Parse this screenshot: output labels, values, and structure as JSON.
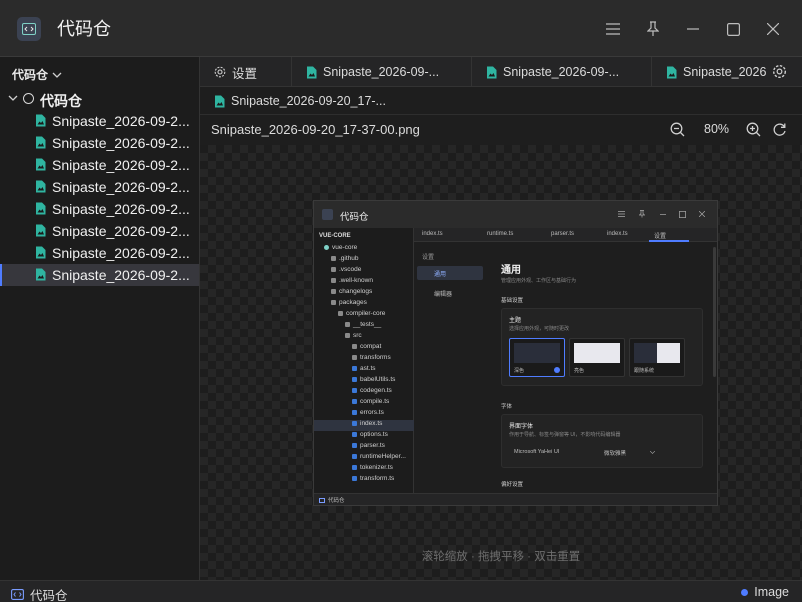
{
  "app": {
    "title": "代码仓",
    "accent": "#4f7cff"
  },
  "sidebar": {
    "header": "代码仓",
    "root": "代码仓",
    "files": [
      "Snipaste_2026-09-2...",
      "Snipaste_2026-09-2...",
      "Snipaste_2026-09-2...",
      "Snipaste_2026-09-2...",
      "Snipaste_2026-09-2...",
      "Snipaste_2026-09-2...",
      "Snipaste_2026-09-2...",
      "Snipaste_2026-09-2..."
    ],
    "active_index": 7
  },
  "tabs": [
    {
      "label": "设置",
      "icon": "gear-icon"
    },
    {
      "label": "Snipaste_2026-09-...",
      "icon": "image-file-icon"
    },
    {
      "label": "Snipaste_2026-09-...",
      "icon": "image-file-icon"
    },
    {
      "label": "Snipaste_2026",
      "icon": "image-file-icon"
    }
  ],
  "tabs_row2": [
    {
      "label": "Snipaste_2026-09-20_17-...",
      "icon": "image-file-icon"
    }
  ],
  "viewer": {
    "filename": "Snipaste_2026-09-20_17-37-00.png",
    "zoom": "80%",
    "hint": "滚轮缩放 · 拖拽平移 · 双击重置"
  },
  "preview": {
    "title": "代码仓",
    "explorer_header": "VUE-CORE",
    "tree": [
      {
        "label": "vue-core",
        "depth": 0,
        "type": "root"
      },
      {
        "label": ".github",
        "depth": 1,
        "type": "folder"
      },
      {
        "label": ".vscode",
        "depth": 1,
        "type": "folder"
      },
      {
        "label": ".well-known",
        "depth": 1,
        "type": "folder"
      },
      {
        "label": "changelogs",
        "depth": 1,
        "type": "folder"
      },
      {
        "label": "packages",
        "depth": 1,
        "type": "folder"
      },
      {
        "label": "compiler-core",
        "depth": 2,
        "type": "folder"
      },
      {
        "label": "__tests__",
        "depth": 3,
        "type": "folder"
      },
      {
        "label": "src",
        "depth": 3,
        "type": "folder"
      },
      {
        "label": "compat",
        "depth": 4,
        "type": "folder"
      },
      {
        "label": "transforms",
        "depth": 4,
        "type": "folder"
      },
      {
        "label": "ast.ts",
        "depth": 4,
        "type": "ts"
      },
      {
        "label": "babelUtils.ts",
        "depth": 4,
        "type": "ts"
      },
      {
        "label": "codegen.ts",
        "depth": 4,
        "type": "ts"
      },
      {
        "label": "compile.ts",
        "depth": 4,
        "type": "ts"
      },
      {
        "label": "errors.ts",
        "depth": 4,
        "type": "ts"
      },
      {
        "label": "index.ts",
        "depth": 4,
        "type": "ts"
      },
      {
        "label": "options.ts",
        "depth": 4,
        "type": "ts"
      },
      {
        "label": "parser.ts",
        "depth": 4,
        "type": "ts"
      },
      {
        "label": "runtimeHelper...",
        "depth": 4,
        "type": "ts"
      },
      {
        "label": "tokenizer.ts",
        "depth": 4,
        "type": "ts"
      },
      {
        "label": "transform.ts",
        "depth": 4,
        "type": "ts"
      }
    ],
    "tabs": [
      "index.ts",
      "runtime.ts",
      "parser.ts",
      "index.ts",
      "设置"
    ],
    "nav_header": "设置",
    "nav": [
      "通用",
      "编辑器"
    ],
    "main_title": "通用",
    "main_subtitle": "管理应用外观、工作区与基础行为",
    "section1": "基础设置",
    "theme_title": "主题",
    "theme_desc": "选择应用外观，可随时更改",
    "themes": [
      "深色",
      "亮色",
      "跟随系统"
    ],
    "section2": "字体",
    "font_title": "界面字体",
    "font_desc": "作用于导航、标签与弹窗等 UI，不影响代码编辑器",
    "font_value": "Microsoft YaHei UI",
    "font_weight": "微软雅黑",
    "section3": "偏好设置",
    "status": "代码仓"
  },
  "statusbar": {
    "left": "代码仓",
    "right": "Image"
  }
}
